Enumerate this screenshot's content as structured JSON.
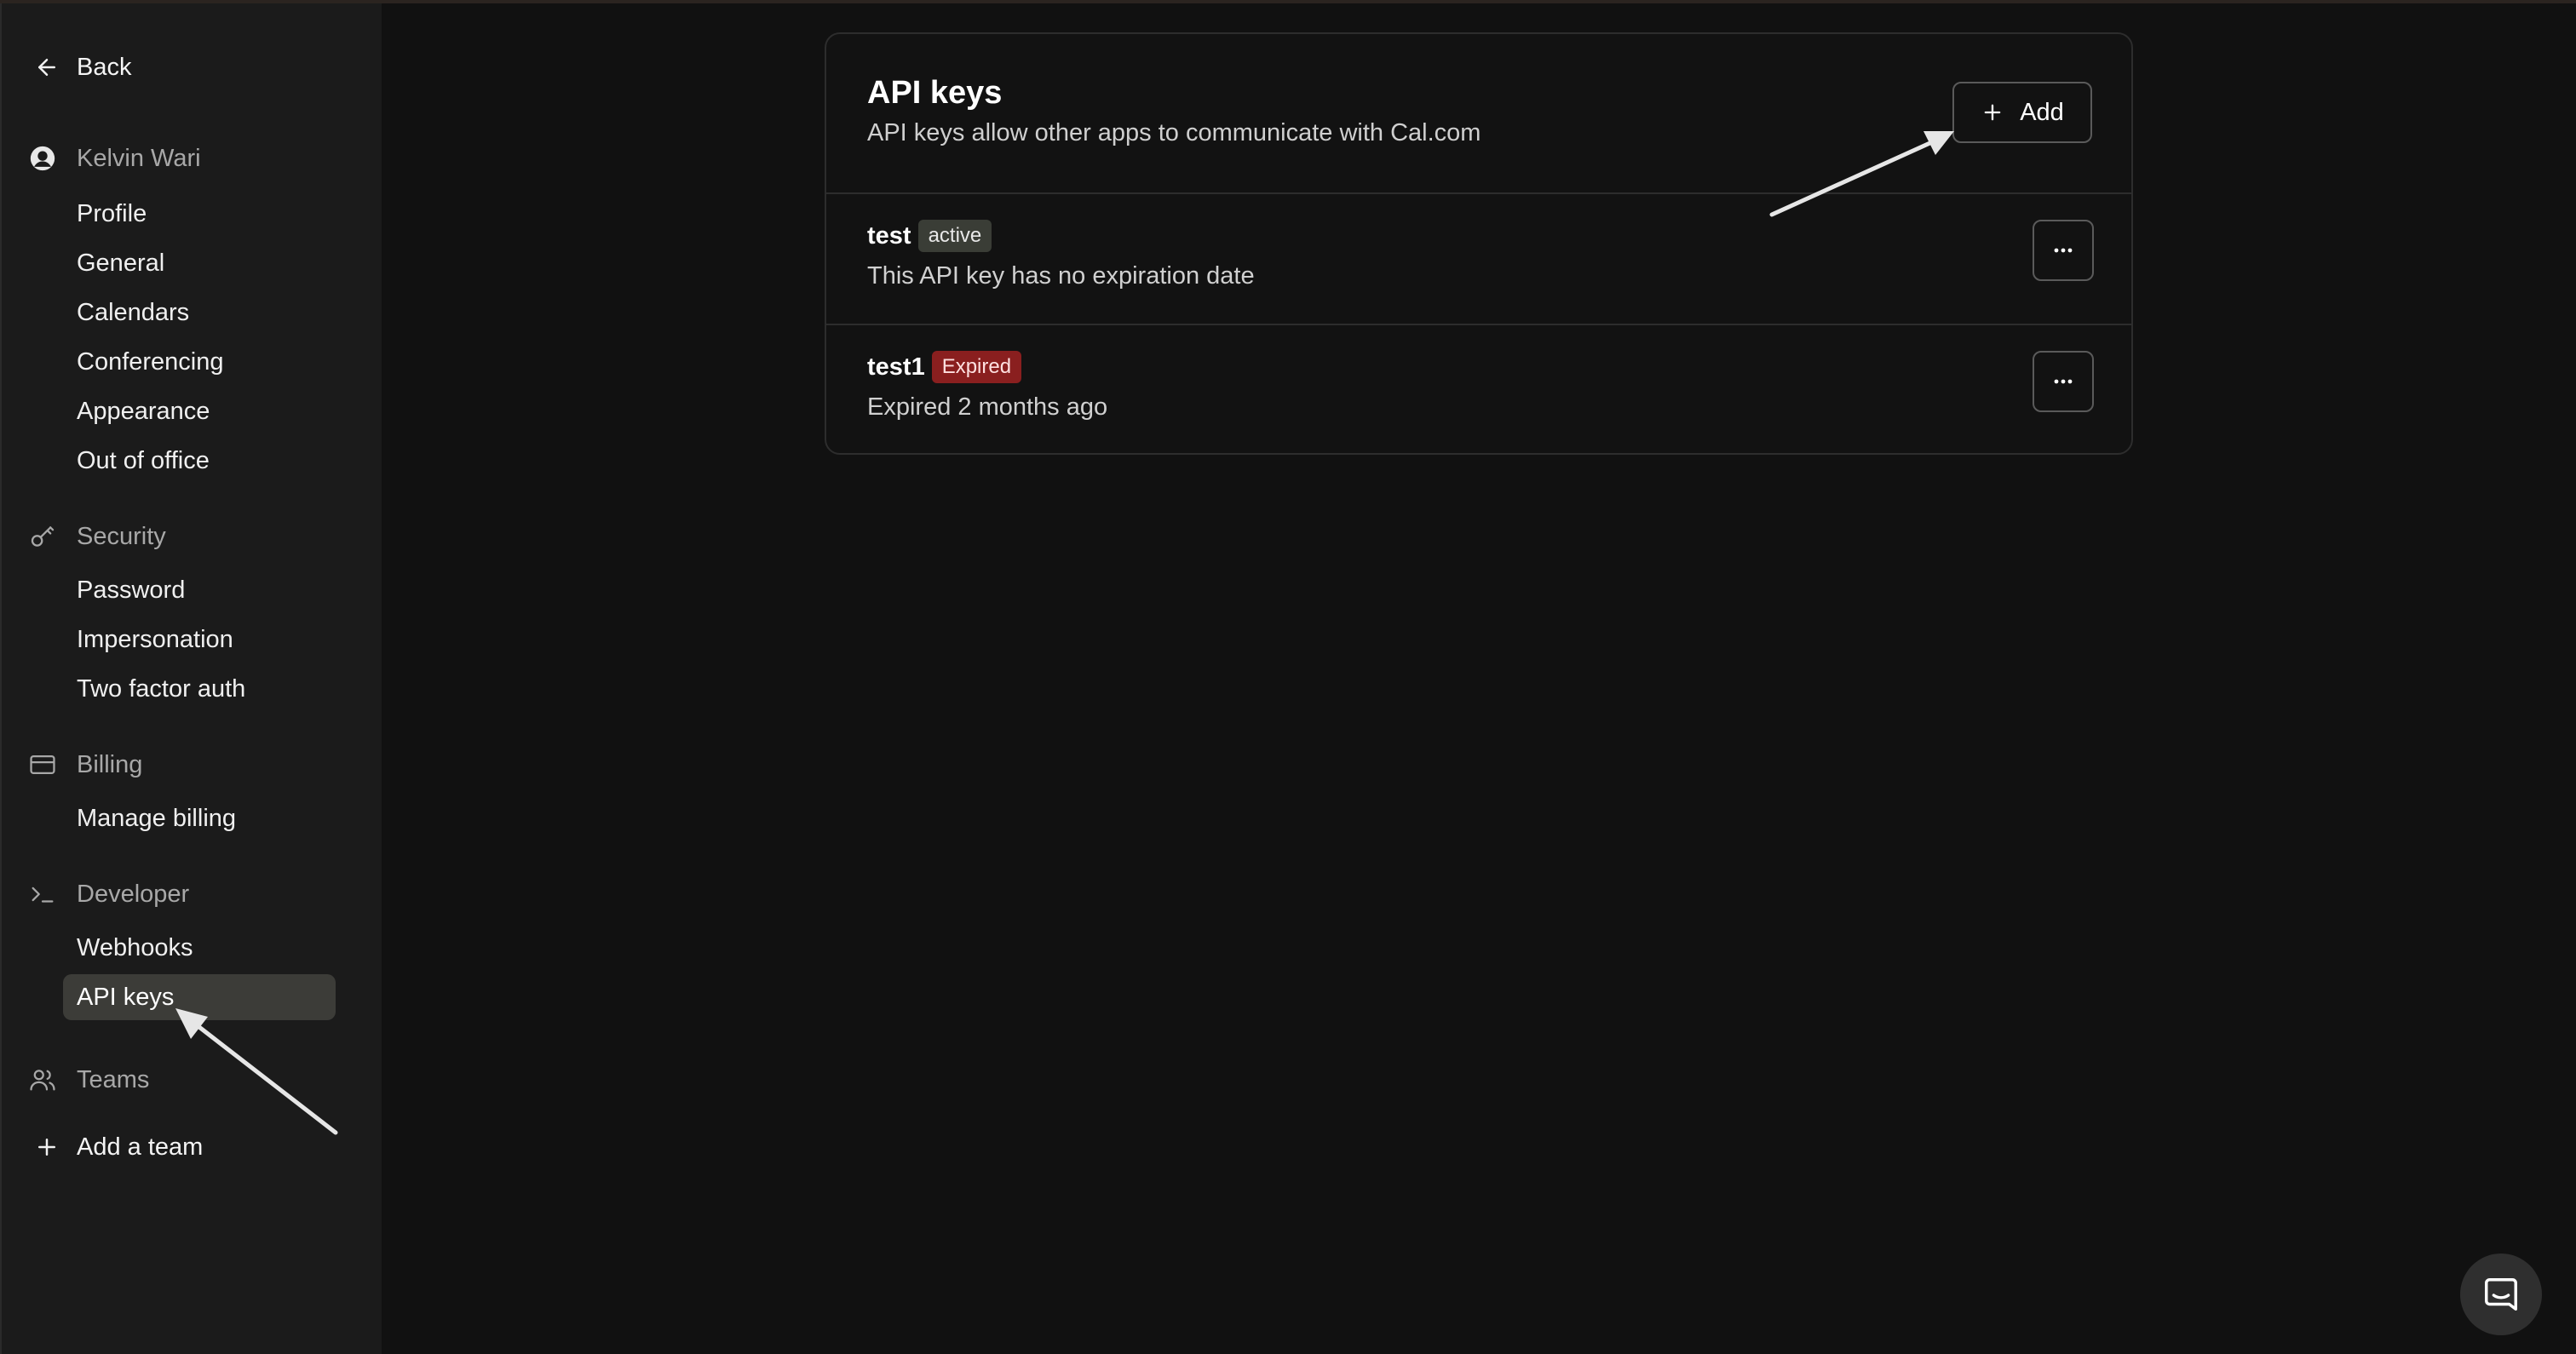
{
  "sidebar": {
    "back_label": "Back",
    "sections": {
      "account": {
        "label": "Kelvin Wari",
        "items": [
          "Profile",
          "General",
          "Calendars",
          "Conferencing",
          "Appearance",
          "Out of office"
        ]
      },
      "security": {
        "label": "Security",
        "items": [
          "Password",
          "Impersonation",
          "Two factor auth"
        ]
      },
      "billing": {
        "label": "Billing",
        "items": [
          "Manage billing"
        ]
      },
      "developer": {
        "label": "Developer",
        "items": [
          "Webhooks",
          "API keys"
        ],
        "active_item": "API keys"
      },
      "teams": {
        "label": "Teams"
      }
    },
    "add_team_label": "Add a team"
  },
  "main": {
    "title": "API keys",
    "subtitle": "API keys allow other apps to communicate with Cal.com",
    "add_label": "Add",
    "keys": [
      {
        "name": "test",
        "status": "active",
        "description": "This API key has no expiration date"
      },
      {
        "name": "test1",
        "status": "Expired",
        "description": "Expired 2 months ago"
      }
    ]
  },
  "colors": {
    "background": "#111111",
    "sidebar": "#1b1b1b",
    "active_nav": "#3c3c38",
    "badge_active": "#3a3d36",
    "badge_expired": "#8a1f1f",
    "border": "#2d2d2d"
  },
  "icons": {
    "back": "arrow-left-icon",
    "account": "user-avatar-icon",
    "security": "key-icon",
    "billing": "credit-card-icon",
    "developer": "terminal-icon",
    "teams": "users-icon",
    "add": "plus-icon",
    "more": "more-horizontal-icon",
    "chat": "chat-icon"
  }
}
